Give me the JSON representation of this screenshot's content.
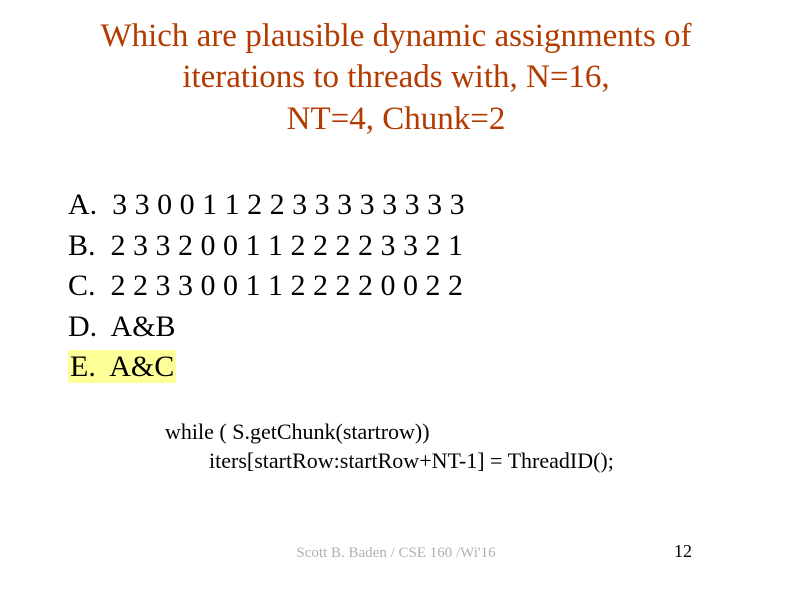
{
  "title": {
    "line1": "Which are plausible dynamic assignments of",
    "line2": "iterations to threads with, N=16,",
    "line3": "NT=4, Chunk=2"
  },
  "options": {
    "a": {
      "letter": "A.",
      "text": "3 3 0 0 1 1 2 2 3 3 3 3 3 3 3 3"
    },
    "b": {
      "letter": "B.",
      "text": "2 3 3 2 0 0 1 1 2 2 2 2 3 3 2 1"
    },
    "c": {
      "letter": "C.",
      "text": "2 2 3 3 0 0 1 1 2 2 2 2 0 0 2 2"
    },
    "d": {
      "letter": "D.",
      "text": "A&B"
    },
    "e": {
      "letter": "E.",
      "text": "A&C"
    }
  },
  "code": {
    "line1": "while ( S.getChunk(startrow))",
    "line2": "        iters[startRow:startRow+NT-1] = ThreadID();"
  },
  "footer": "Scott B. Baden / CSE 160 /Wi'16",
  "pagenum": "12"
}
